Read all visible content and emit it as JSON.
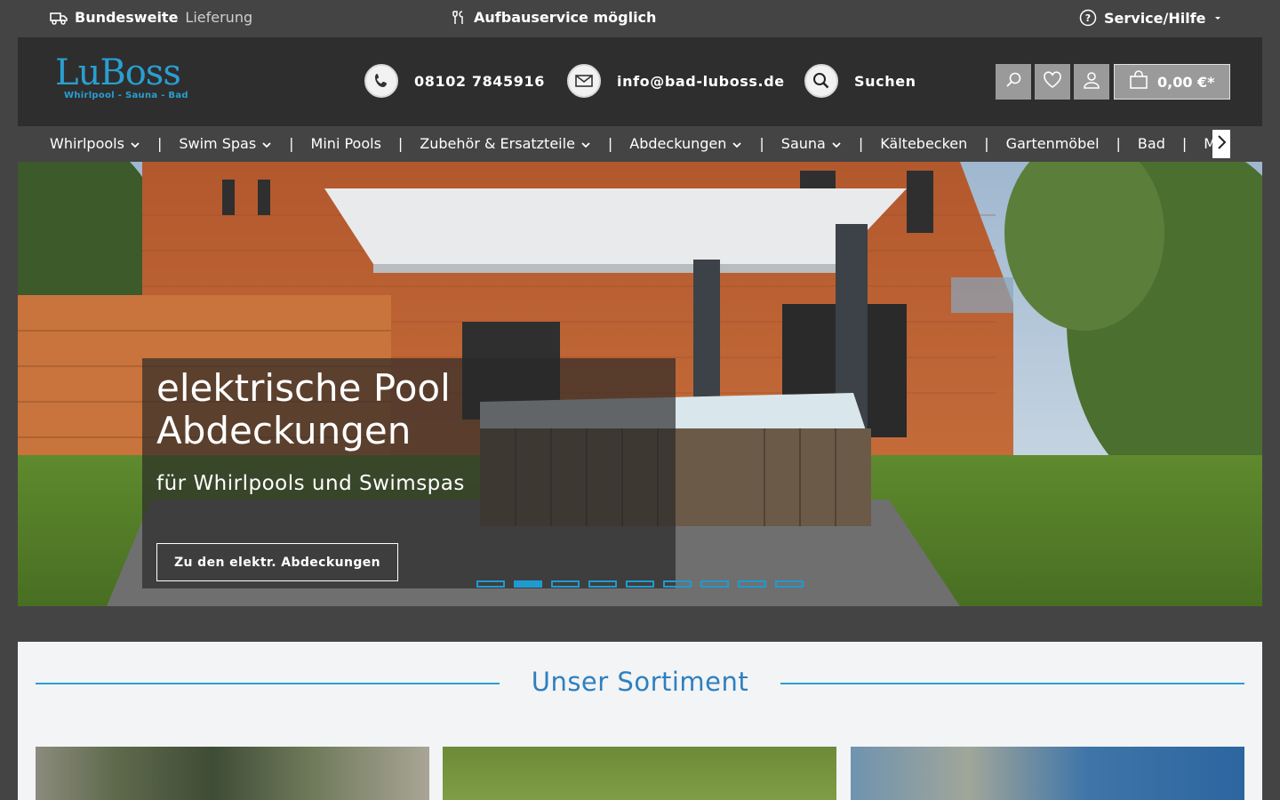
{
  "topbar": {
    "delivery_bold": "Bundesweite",
    "delivery_light": "Lieferung",
    "assembly": "Aufbauservice möglich",
    "service": "Service/Hilfe"
  },
  "header": {
    "logo_main": "LuBoss",
    "logo_sub": "Whirlpool - Sauna - Bad",
    "phone": "08102 7845916",
    "email": "info@bad-luboss.de",
    "search_label": "Suchen",
    "cart_total": "0,00 €*"
  },
  "nav": {
    "items": [
      {
        "label": "Whirlpools",
        "dropdown": true
      },
      {
        "label": "Swim Spas",
        "dropdown": true
      },
      {
        "label": "Mini Pools",
        "dropdown": false
      },
      {
        "label": "Zubehör & Ersatzteile",
        "dropdown": true
      },
      {
        "label": "Abdeckungen",
        "dropdown": true
      },
      {
        "label": "Sauna",
        "dropdown": true
      },
      {
        "label": "Kältebecken",
        "dropdown": false
      },
      {
        "label": "Gartenmöbel",
        "dropdown": false
      },
      {
        "label": "Bad",
        "dropdown": false
      },
      {
        "label": "Massagesessel",
        "dropdown": false
      }
    ],
    "separator": "|"
  },
  "hero": {
    "title": "elektrische Pool Abdeckungen",
    "subtitle": "für Whirlpools und Swimspas",
    "cta": "Zu den elektr. Abdeckungen",
    "slide_count": 9,
    "active_slide": 2
  },
  "sortiment": {
    "title": "Unser Sortiment"
  },
  "colors": {
    "accent": "#1f9bd1",
    "title_blue": "#2f7fbf",
    "header_bg": "#2e2e2e",
    "page_bg": "#444444"
  },
  "icons": {
    "delivery": "truck-icon",
    "assembly": "tools-icon",
    "service": "help-circle-icon",
    "phone": "phone-icon",
    "mail": "mail-icon",
    "search": "search-icon",
    "wishlist": "heart-icon",
    "account": "user-icon",
    "cart": "shopping-bag-icon",
    "nav_next": "chevron-right-icon"
  }
}
